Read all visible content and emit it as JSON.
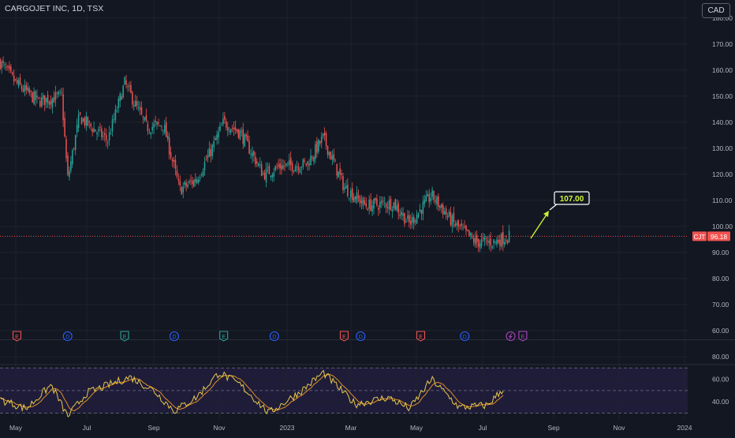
{
  "header": {
    "title": "CARGOJET INC, 1D, TSX",
    "currency_button": "CAD"
  },
  "colors": {
    "background": "#131722",
    "grid": "#1e222d",
    "up": "#26a69a",
    "down": "#ef5350",
    "axis_text": "#b2b5be",
    "last_price_line": "#ef5350",
    "rsi_line": "#e8c94b",
    "rsi_ma_line": "#f59b25",
    "rsi_band_fill": "#1f1c3a",
    "rsi_band_border": "#6b6f7d",
    "arrow": "#c8f135",
    "target_label_text": "#d6f53a",
    "dividend_badge": "#2962ff",
    "earnings_badge_red": "#ef5350",
    "earnings_badge_green": "#26a69a",
    "split_badge": "#ab47bc"
  },
  "chart_data": {
    "type": "candlestick",
    "symbol": "CJT",
    "exchange": "TSX",
    "interval": "1D",
    "x_tick_labels": [
      "May",
      "Jul",
      "Sep",
      "Nov",
      "2023",
      "Mar",
      "May",
      "Jul",
      "Sep",
      "Nov",
      "2024"
    ],
    "price_axis": {
      "ticks": [
        180,
        170,
        160,
        150,
        140,
        130,
        120,
        110,
        100,
        90,
        80,
        70,
        60
      ],
      "tick_labels": [
        "180.00",
        "170.00",
        "160.00",
        "150.00",
        "140.00",
        "130.00",
        "120.00",
        "110.00",
        "100.00",
        "90.00",
        "80.00",
        "70.00",
        "60.00"
      ],
      "ylim": [
        58,
        183
      ],
      "grid": true
    },
    "last_price": {
      "ticker_label": "CJT",
      "value": 96.18,
      "label": "96.18"
    },
    "target": {
      "value": 107.0,
      "label": "107.00"
    },
    "approx_close_path": [
      {
        "date": "2022-04-18",
        "close": 163
      },
      {
        "date": "2022-05-01",
        "close": 155
      },
      {
        "date": "2022-05-20",
        "close": 148
      },
      {
        "date": "2022-06-10",
        "close": 150
      },
      {
        "date": "2022-06-15",
        "close": 118
      },
      {
        "date": "2022-06-25",
        "close": 142
      },
      {
        "date": "2022-07-20",
        "close": 133
      },
      {
        "date": "2022-08-05",
        "close": 155
      },
      {
        "date": "2022-08-25",
        "close": 138
      },
      {
        "date": "2022-09-10",
        "close": 139
      },
      {
        "date": "2022-09-25",
        "close": 114
      },
      {
        "date": "2022-10-10",
        "close": 118
      },
      {
        "date": "2022-10-25",
        "close": 130
      },
      {
        "date": "2022-11-05",
        "close": 140
      },
      {
        "date": "2022-11-20",
        "close": 136
      },
      {
        "date": "2022-12-10",
        "close": 120
      },
      {
        "date": "2022-12-25",
        "close": 123
      },
      {
        "date": "2023-01-20",
        "close": 124
      },
      {
        "date": "2023-02-05",
        "close": 134
      },
      {
        "date": "2023-02-25",
        "close": 115
      },
      {
        "date": "2023-03-15",
        "close": 108
      },
      {
        "date": "2023-04-10",
        "close": 109
      },
      {
        "date": "2023-04-25",
        "close": 101
      },
      {
        "date": "2023-05-15",
        "close": 112
      },
      {
        "date": "2023-06-05",
        "close": 101
      },
      {
        "date": "2023-06-25",
        "close": 94
      },
      {
        "date": "2023-07-10",
        "close": 94
      },
      {
        "date": "2023-07-24",
        "close": 96.18
      }
    ],
    "rsi": {
      "axis_ticks": [
        80,
        60,
        40
      ],
      "tick_labels": [
        "80.00",
        "60.00",
        "40.00"
      ],
      "band_upper": 70,
      "band_middle": 50,
      "band_lower": 30,
      "approx_values": [
        {
          "date": "2022-04-18",
          "value": 42
        },
        {
          "date": "2022-05-10",
          "value": 34
        },
        {
          "date": "2022-06-01",
          "value": 55
        },
        {
          "date": "2022-06-15",
          "value": 27
        },
        {
          "date": "2022-07-01",
          "value": 48
        },
        {
          "date": "2022-08-10",
          "value": 62
        },
        {
          "date": "2022-09-01",
          "value": 50
        },
        {
          "date": "2022-09-20",
          "value": 32
        },
        {
          "date": "2022-10-10",
          "value": 44
        },
        {
          "date": "2022-11-01",
          "value": 66
        },
        {
          "date": "2022-11-20",
          "value": 55
        },
        {
          "date": "2022-12-15",
          "value": 30
        },
        {
          "date": "2023-01-15",
          "value": 50
        },
        {
          "date": "2023-02-05",
          "value": 66
        },
        {
          "date": "2023-03-05",
          "value": 38
        },
        {
          "date": "2023-04-05",
          "value": 44
        },
        {
          "date": "2023-04-25",
          "value": 34
        },
        {
          "date": "2023-05-15",
          "value": 60
        },
        {
          "date": "2023-06-10",
          "value": 35
        },
        {
          "date": "2023-07-05",
          "value": 37
        },
        {
          "date": "2023-07-20",
          "value": 53
        }
      ]
    },
    "events": [
      {
        "type": "earnings",
        "label": "E",
        "date": "2022-05-02",
        "color": "red"
      },
      {
        "type": "dividend",
        "label": "D",
        "date": "2022-06-15",
        "color": "blue"
      },
      {
        "type": "earnings",
        "label": "E",
        "date": "2022-08-05",
        "color": "green"
      },
      {
        "type": "dividend",
        "label": "D",
        "date": "2022-09-20",
        "color": "blue"
      },
      {
        "type": "earnings",
        "label": "E",
        "date": "2022-11-05",
        "color": "green"
      },
      {
        "type": "dividend",
        "label": "D",
        "date": "2022-12-20",
        "color": "blue"
      },
      {
        "type": "earnings",
        "label": "E",
        "date": "2023-02-25",
        "color": "red"
      },
      {
        "type": "dividend",
        "label": "D",
        "date": "2023-03-10",
        "color": "blue"
      },
      {
        "type": "earnings",
        "label": "E",
        "date": "2023-05-05",
        "color": "red"
      },
      {
        "type": "dividend",
        "label": "D",
        "date": "2023-06-15",
        "color": "blue"
      },
      {
        "type": "split",
        "label": "",
        "date": "2023-07-25",
        "color": "purple"
      },
      {
        "type": "earnings",
        "label": "E",
        "date": "2023-08-05",
        "color": "purple"
      }
    ]
  }
}
